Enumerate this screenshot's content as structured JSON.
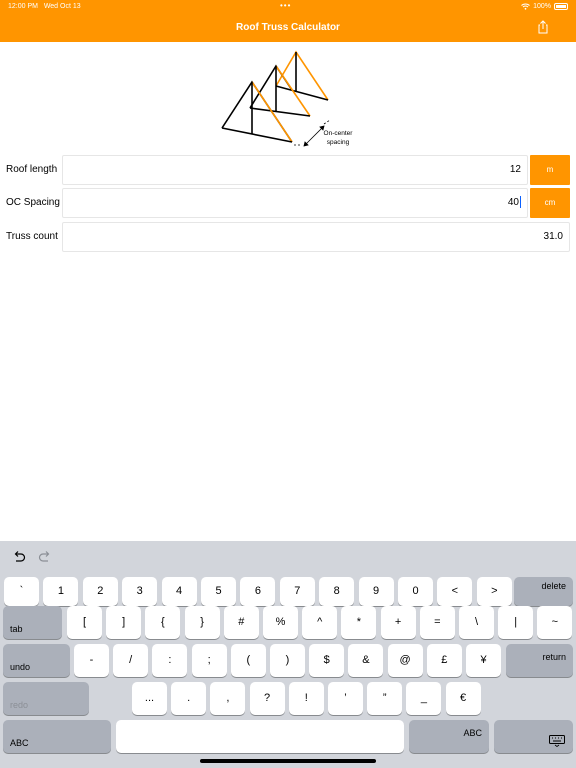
{
  "status_bar": {
    "time": "12:00 PM",
    "date": "Wed Oct 13",
    "battery": "100%"
  },
  "header": {
    "title": "Roof Truss Calculator"
  },
  "diagram": {
    "annotation_line1": "On-center",
    "annotation_line2": "spacing"
  },
  "colors": {
    "accent": "#ff9500",
    "keyboard_bg": "#d2d5db",
    "dark_key": "#abb0ba",
    "caret": "#0a60ff"
  },
  "fields": {
    "roof_length": {
      "label": "Roof length",
      "value": "12",
      "unit": "m"
    },
    "oc_spacing": {
      "label": "OC Spacing",
      "value": "40",
      "unit": "cm"
    },
    "truss_count": {
      "label": "Truss count",
      "value": "31.0"
    }
  },
  "keyboard": {
    "toolbar": {
      "undo_icon": "undo-icon",
      "redo_icon": "redo-icon"
    },
    "row1": [
      "`",
      "1",
      "2",
      "3",
      "4",
      "5",
      "6",
      "7",
      "8",
      "9",
      "0",
      "<",
      ">"
    ],
    "delete": "delete",
    "tab": "tab",
    "row2": [
      "[",
      "]",
      "{",
      "}",
      "#",
      "%",
      "^",
      "*",
      "+",
      "=",
      "\\",
      "|",
      "~"
    ],
    "undo": "undo",
    "row3": [
      "-",
      "/",
      ":",
      ";",
      "(",
      ")",
      "$",
      "&",
      "@",
      "£",
      "¥"
    ],
    "return": "return",
    "redo": "redo",
    "row4": [
      "...",
      ".",
      ",",
      "?",
      "!",
      "’",
      "”",
      "_",
      "€"
    ],
    "abc_left": "ABC",
    "abc_right": "ABC",
    "dismiss_icon": "keyboard-dismiss-icon"
  }
}
